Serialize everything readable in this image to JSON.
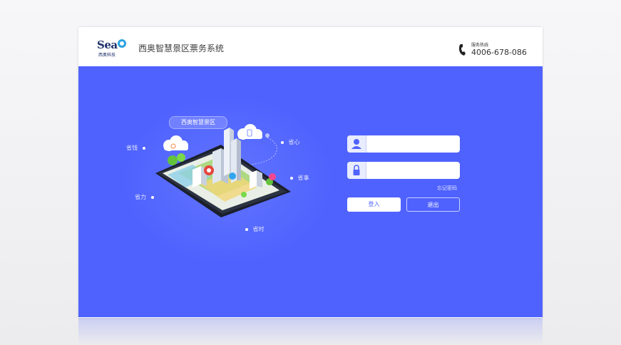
{
  "brand": {
    "logo_word": "Sea",
    "logo_sub": "西奥科技",
    "app_title": "西奥智慧景区票务系统"
  },
  "hotline": {
    "label": "服务热线",
    "number": "4006-678-086"
  },
  "illustration": {
    "badge": "西奥智慧景区",
    "benefits": [
      "省钱",
      "省心",
      "省事",
      "省力",
      "省时"
    ]
  },
  "login": {
    "username_placeholder": "",
    "password_placeholder": "",
    "forgot_password": "忘记密码",
    "login_label": "登入",
    "exit_label": "退出"
  },
  "colors": {
    "primary": "#4f62fe",
    "logo": "#1d2f6a",
    "logo_ring": "#2aa3e0"
  }
}
